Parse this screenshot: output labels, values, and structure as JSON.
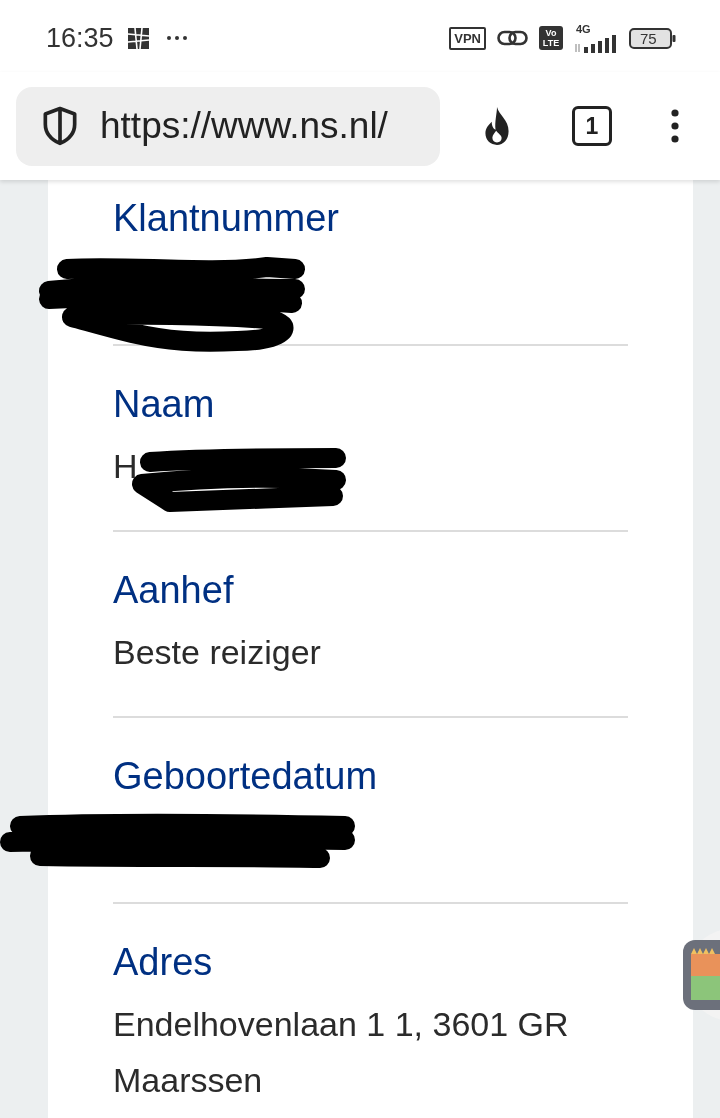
{
  "status_bar": {
    "time": "16:35",
    "vpn": "VPN",
    "volte": "Vo LTE",
    "network": "4G",
    "battery": "75"
  },
  "browser": {
    "url": "https://www.ns.nl/",
    "tab_count": "1"
  },
  "fields": [
    {
      "label": "Klantnummer",
      "redacted": true
    },
    {
      "label": "Naam",
      "value": "H",
      "redacted": true
    },
    {
      "label": "Aanhef",
      "value": "Beste reiziger",
      "redacted": false
    },
    {
      "label": "Geboortedatum",
      "redacted": true
    },
    {
      "label": "Adres",
      "value": "Endelhovenlaan 1 1, 3601 GR Maarssen",
      "redacted": false
    }
  ]
}
